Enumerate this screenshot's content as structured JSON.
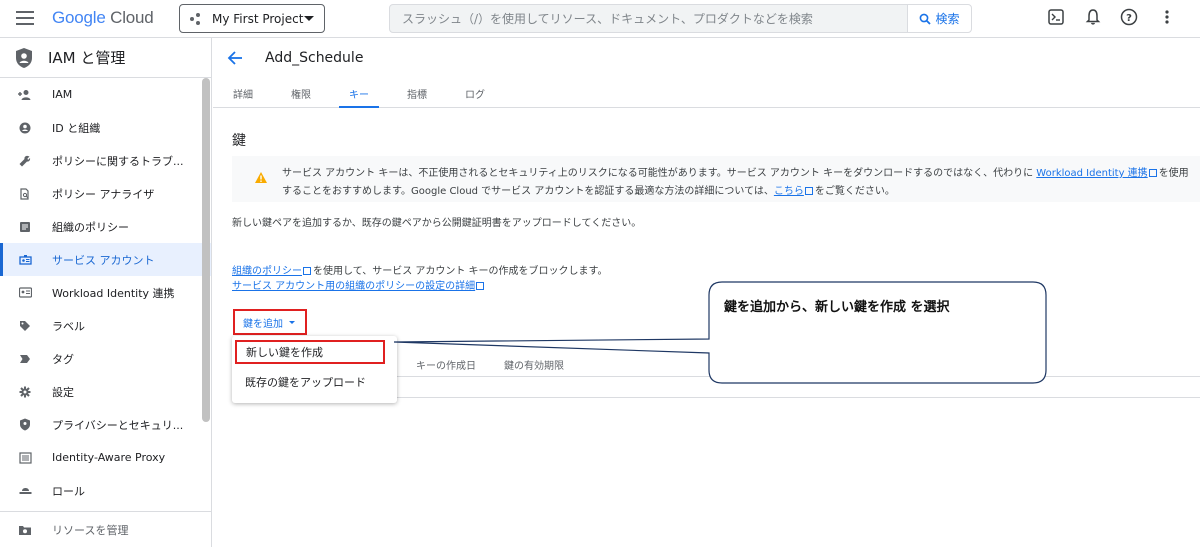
{
  "header": {
    "logo_google": "Google",
    "logo_cloud": " Cloud",
    "project_name": "My First Project",
    "search_placeholder": "スラッシュ（/）を使用してリソース、ドキュメント、プロダクトなどを検索",
    "search_button_label": "検索",
    "icons": [
      "terminal-icon",
      "bell-icon",
      "help-icon",
      "more-vert-icon"
    ]
  },
  "sidebar": {
    "title": "IAM と管理",
    "items": [
      {
        "label": "IAM",
        "icon": "person-add-icon"
      },
      {
        "label": "ID と組織",
        "icon": "account-circle-icon"
      },
      {
        "label": "ポリシーに関するトラブ...",
        "icon": "wrench-icon"
      },
      {
        "label": "ポリシー アナライザ",
        "icon": "document-search-icon"
      },
      {
        "label": "組織のポリシー",
        "icon": "article-icon"
      },
      {
        "label": "サービス アカウント",
        "icon": "service-account-icon",
        "active": true
      },
      {
        "label": "Workload Identity 連携",
        "icon": "id-card-icon"
      },
      {
        "label": "ラベル",
        "icon": "label-icon"
      },
      {
        "label": "タグ",
        "icon": "tag-icon"
      },
      {
        "label": "設定",
        "icon": "gear-icon"
      },
      {
        "label": "プライバシーとセキュリ...",
        "icon": "shield-icon"
      },
      {
        "label": "Identity-Aware Proxy",
        "icon": "proxy-icon"
      },
      {
        "label": "ロール",
        "icon": "hat-icon"
      }
    ],
    "footer_label": "リソースを管理"
  },
  "page": {
    "title": "Add_Schedule",
    "tabs": [
      {
        "label": "詳細"
      },
      {
        "label": "権限"
      },
      {
        "label": "キー",
        "active": true
      },
      {
        "label": "指標"
      },
      {
        "label": "ログ"
      }
    ],
    "section_title": "鍵",
    "warning": {
      "text1": "サービス アカウント キーは、不正使用されるとセキュリティ上のリスクになる可能性があります。サービス アカウント キーをダウンロードするのではなく、代わりに ",
      "link1": "Workload Identity 連携",
      "text2": "を使用することをおすすめします。Google Cloud でサービス アカウントを認証する最適な方法の詳細については、",
      "link2": "こちら",
      "text3": "をご覧ください。"
    },
    "description": "新しい鍵ペアを追加するか、既存の鍵ペアから公開鍵証明書をアップロードしてください。",
    "policy_link": "組織のポリシー",
    "policy_text": "を使用して、サービス アカウント キーの作成をブロックします。",
    "policy_link2": "サービス アカウント用の組織のポリシーの設定の詳細",
    "add_key_label": "鍵を追加",
    "table_headers": [
      "キーの作成日",
      "鍵の有効期限"
    ],
    "dropdown": {
      "items": [
        "新しい鍵を作成",
        "既存の鍵をアップロード"
      ]
    }
  },
  "callout": {
    "text": "鍵を追加から、新しい鍵を作成 を選択"
  },
  "colors": {
    "accent": "#1a73e8",
    "highlight": "#e02020",
    "warning": "#f9ab00",
    "callout_border": "#1f3864"
  }
}
